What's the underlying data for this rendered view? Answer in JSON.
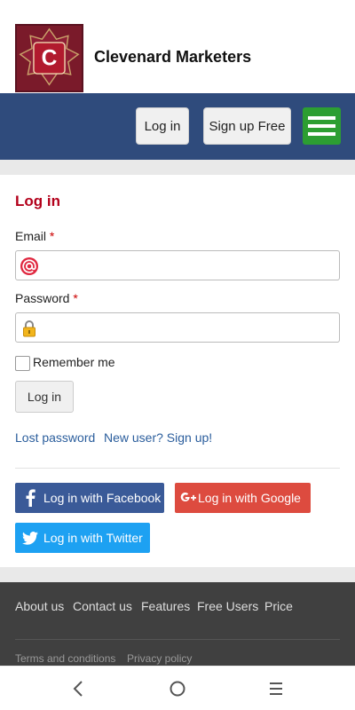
{
  "brand": {
    "logo_letter": "C",
    "name": "Clevenard Marketers"
  },
  "nav": {
    "login": "Log in",
    "signup": "Sign up Free"
  },
  "form": {
    "title": "Log in",
    "email_label": "Email",
    "password_label": "Password",
    "required_mark": "*",
    "email_value": "",
    "password_value": "",
    "remember_label": "Remember me",
    "remember_checked": false,
    "submit": "Log in",
    "lost_password": "Lost password",
    "new_user": "New user? Sign up!"
  },
  "social": {
    "facebook": "Log in with Facebook",
    "google": "Log in with Google",
    "twitter": "Log in with Twitter"
  },
  "footer": {
    "links": [
      "About us",
      "Contact us",
      "Features",
      "Free Users",
      "Price"
    ],
    "small_links": [
      "Terms and conditions",
      "Privacy policy"
    ]
  },
  "colors": {
    "nav_bg": "#2f4b7c",
    "hamburger": "#2c9e32",
    "title_red": "#b3001b",
    "facebook": "#3a5a98",
    "google": "#dd4b3f",
    "twitter": "#1da1f2",
    "footer_bg": "#404040"
  },
  "icons": [
    "logo-icon",
    "menu-icon",
    "email-at-icon",
    "lock-icon",
    "facebook-icon",
    "google-plus-icon",
    "twitter-icon",
    "back-icon",
    "home-icon",
    "recents-icon"
  ]
}
